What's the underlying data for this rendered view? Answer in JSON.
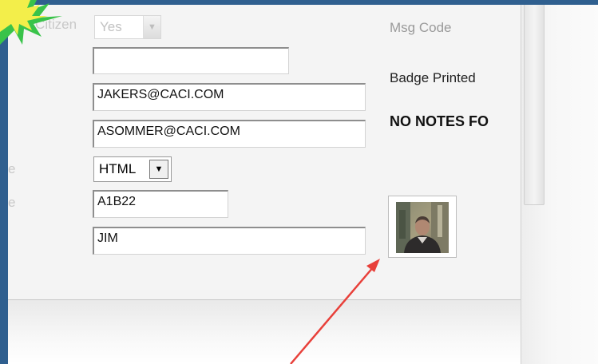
{
  "form": {
    "citizen_label": "S Citizen",
    "citizen_value": "Yes",
    "blank_field_value": "",
    "email_1": "JAKERS@CACI.COM",
    "email_2": "ASOMMER@CACI.COM",
    "format_value": "HTML",
    "partial_label_1": "e",
    "partial_label_2": "e",
    "code_value": "A1B22",
    "name_value": "JIM"
  },
  "right_panel": {
    "msg_code_label": "Msg Code",
    "badge_printed_label": "Badge Printed",
    "notes_text": "NO NOTES FO"
  },
  "icons": {
    "dropdown": "chevron-down-icon",
    "photo": "user-photo",
    "annotation": "red-arrow",
    "burst": "star-burst"
  },
  "colors": {
    "page_bg": "#2f5f8f",
    "annotation_arrow": "#e8403a",
    "burst_outer": "#39c34a",
    "burst_inner": "#f3ee4a"
  }
}
